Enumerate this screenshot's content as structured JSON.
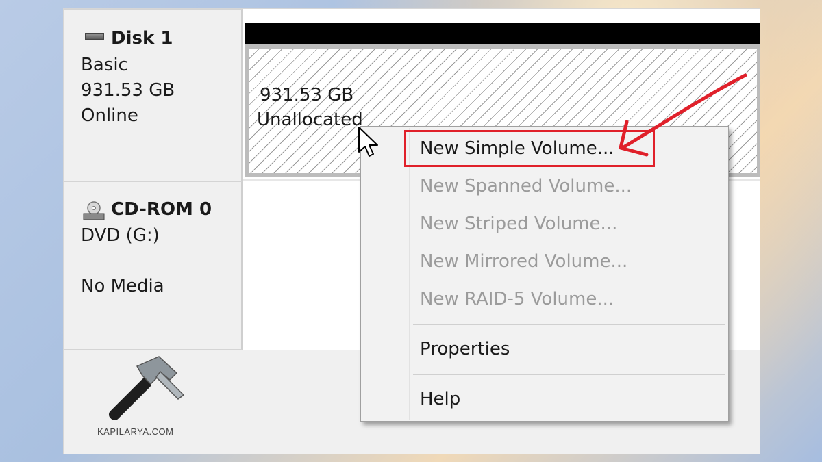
{
  "disk1": {
    "title": "Disk 1",
    "type": "Basic",
    "size": "931.53 GB",
    "status": "Online"
  },
  "cdrom": {
    "title": "CD-ROM 0",
    "drive": "DVD (G:)",
    "media": "No Media"
  },
  "partition": {
    "size": "931.53 GB",
    "state": "Unallocated"
  },
  "context_menu": {
    "items": [
      {
        "label": "New Simple Volume...",
        "enabled": true
      },
      {
        "label": "New Spanned Volume...",
        "enabled": false
      },
      {
        "label": "New Striped Volume...",
        "enabled": false
      },
      {
        "label": "New Mirrored Volume...",
        "enabled": false
      },
      {
        "label": "New RAID-5 Volume...",
        "enabled": false
      },
      {
        "label": "Properties",
        "enabled": true
      },
      {
        "label": "Help",
        "enabled": true
      }
    ]
  },
  "watermark": {
    "text": "KAPILARYA.COM",
    "icon": "hammer-icon"
  },
  "colors": {
    "highlight": "#e0202a",
    "disabled_text": "#9b9b9b",
    "menu_bg": "#f2f2f2"
  }
}
